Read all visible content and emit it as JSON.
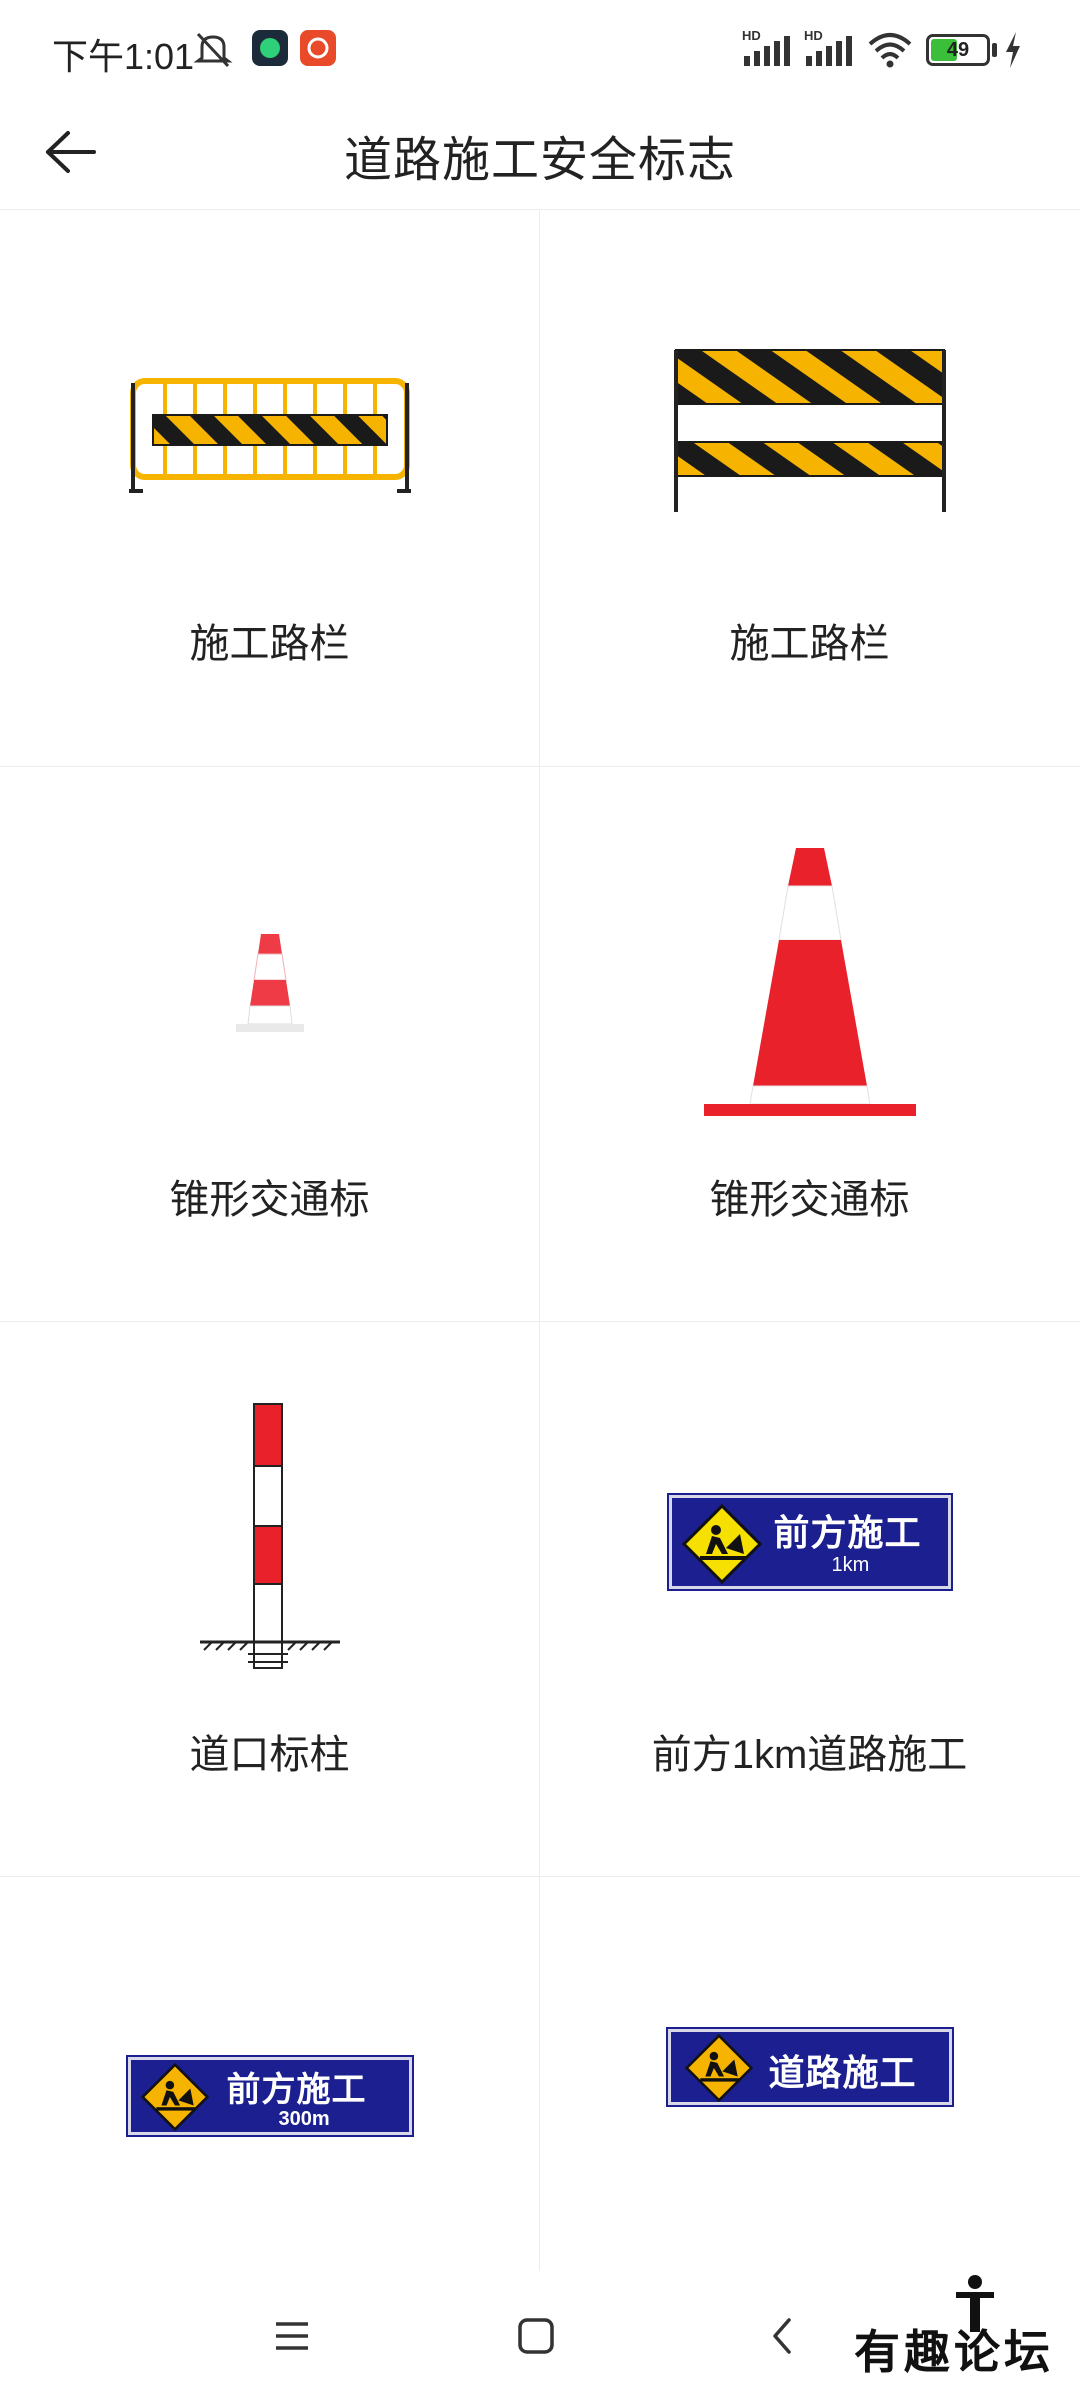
{
  "status_bar": {
    "time": "下午1:01",
    "battery": "49",
    "hd1": "HD",
    "hd2": "HD"
  },
  "header": {
    "title": "道路施工安全标志"
  },
  "items": [
    {
      "label": "施工路栏",
      "icon": "barrier-fence-icon"
    },
    {
      "label": "施工路栏",
      "icon": "barrier-board-icon"
    },
    {
      "label": "锥形交通标",
      "icon": "small-cone-icon"
    },
    {
      "label": "锥形交通标",
      "icon": "large-cone-icon"
    },
    {
      "label": "道口标柱",
      "icon": "crossing-post-icon"
    },
    {
      "label": "前方1km道路施工",
      "icon": "road-work-1km-sign-icon"
    },
    {
      "label": "",
      "icon": "road-work-300m-sign-icon"
    },
    {
      "label": "",
      "icon": "road-work-sign-icon"
    }
  ],
  "signs": {
    "ahead": "前方施工",
    "dist_1km": "1km",
    "dist_300m": "300m",
    "road_work": "道路施工"
  },
  "watermark": "有趣论坛",
  "colors": {
    "sign_blue": "#1b1f8f",
    "warning_yellow": "#f6c000",
    "cone_red": "#e8212b"
  }
}
